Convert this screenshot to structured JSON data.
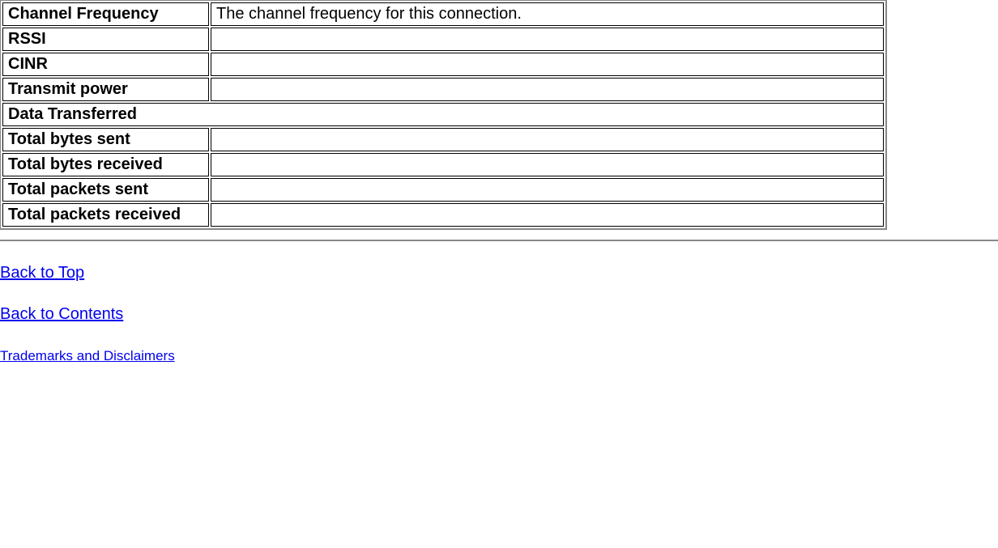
{
  "table": {
    "rows": [
      {
        "label": "Channel Frequency",
        "value": "The channel frequency for this connection."
      },
      {
        "label": "RSSI",
        "value": ""
      },
      {
        "label": "CINR",
        "value": ""
      },
      {
        "label": "Transmit power",
        "value": ""
      }
    ],
    "section_header": "Data Transferred",
    "rows2": [
      {
        "label": "Total bytes sent",
        "value": ""
      },
      {
        "label": "Total bytes received",
        "value": ""
      },
      {
        "label": "Total packets sent",
        "value": ""
      },
      {
        "label": "Total packets received",
        "value": ""
      }
    ]
  },
  "links": {
    "back_to_top": "Back to Top",
    "back_to_contents": "Back to Contents",
    "trademarks": "Trademarks and Disclaimers"
  }
}
